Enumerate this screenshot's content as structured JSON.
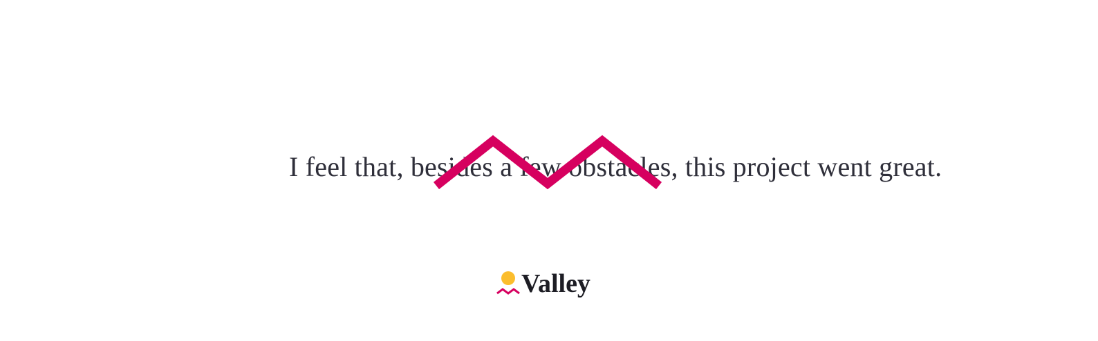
{
  "quote": {
    "text": "I feel that, besides a few obstacles, this project went great."
  },
  "decoration": {
    "icon": "zigzag-mountains-icon",
    "color": "#d6005f"
  },
  "brand": {
    "name": "Valley",
    "icon": "valley-logo-icon",
    "sun_color": "#fbbd2d",
    "wave_color": "#d6005f"
  }
}
